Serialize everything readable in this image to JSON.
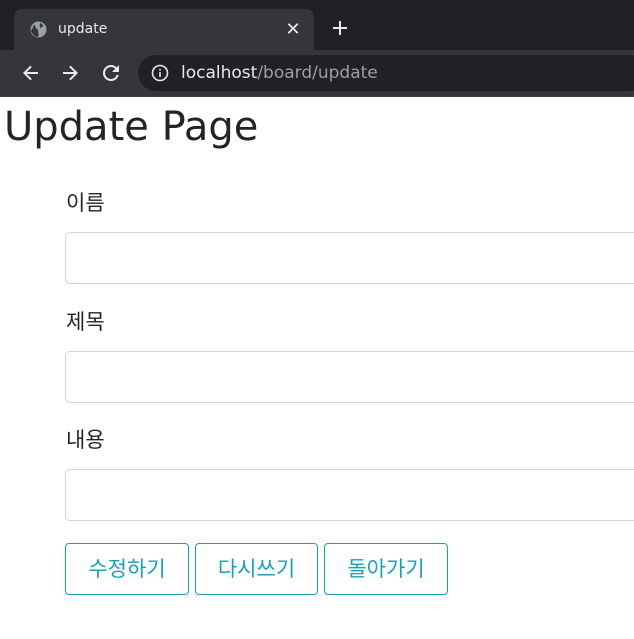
{
  "browser": {
    "tab": {
      "title": "update",
      "favicon": "globe-icon",
      "close_icon": "close-icon"
    },
    "new_tab_icon": "plus-icon",
    "nav": {
      "back_icon": "back-arrow-icon",
      "forward_icon": "forward-arrow-icon",
      "reload_icon": "reload-icon"
    },
    "address_bar": {
      "info_icon": "info-icon",
      "host": "localhost",
      "path": "/board/update"
    }
  },
  "page": {
    "title": "Update Page",
    "form": {
      "fields": [
        {
          "label": "이름",
          "value": ""
        },
        {
          "label": "제목",
          "value": ""
        },
        {
          "label": "내용",
          "value": ""
        }
      ],
      "buttons": {
        "submit": "수정하기",
        "reset": "다시쓰기",
        "back": "돌아가기"
      },
      "button_color": "#17a2b8"
    }
  },
  "colors": {
    "tabstrip_bg": "#202124",
    "toolbar_bg": "#35363a",
    "text_dark": "#212529",
    "input_border": "#ced4da"
  }
}
